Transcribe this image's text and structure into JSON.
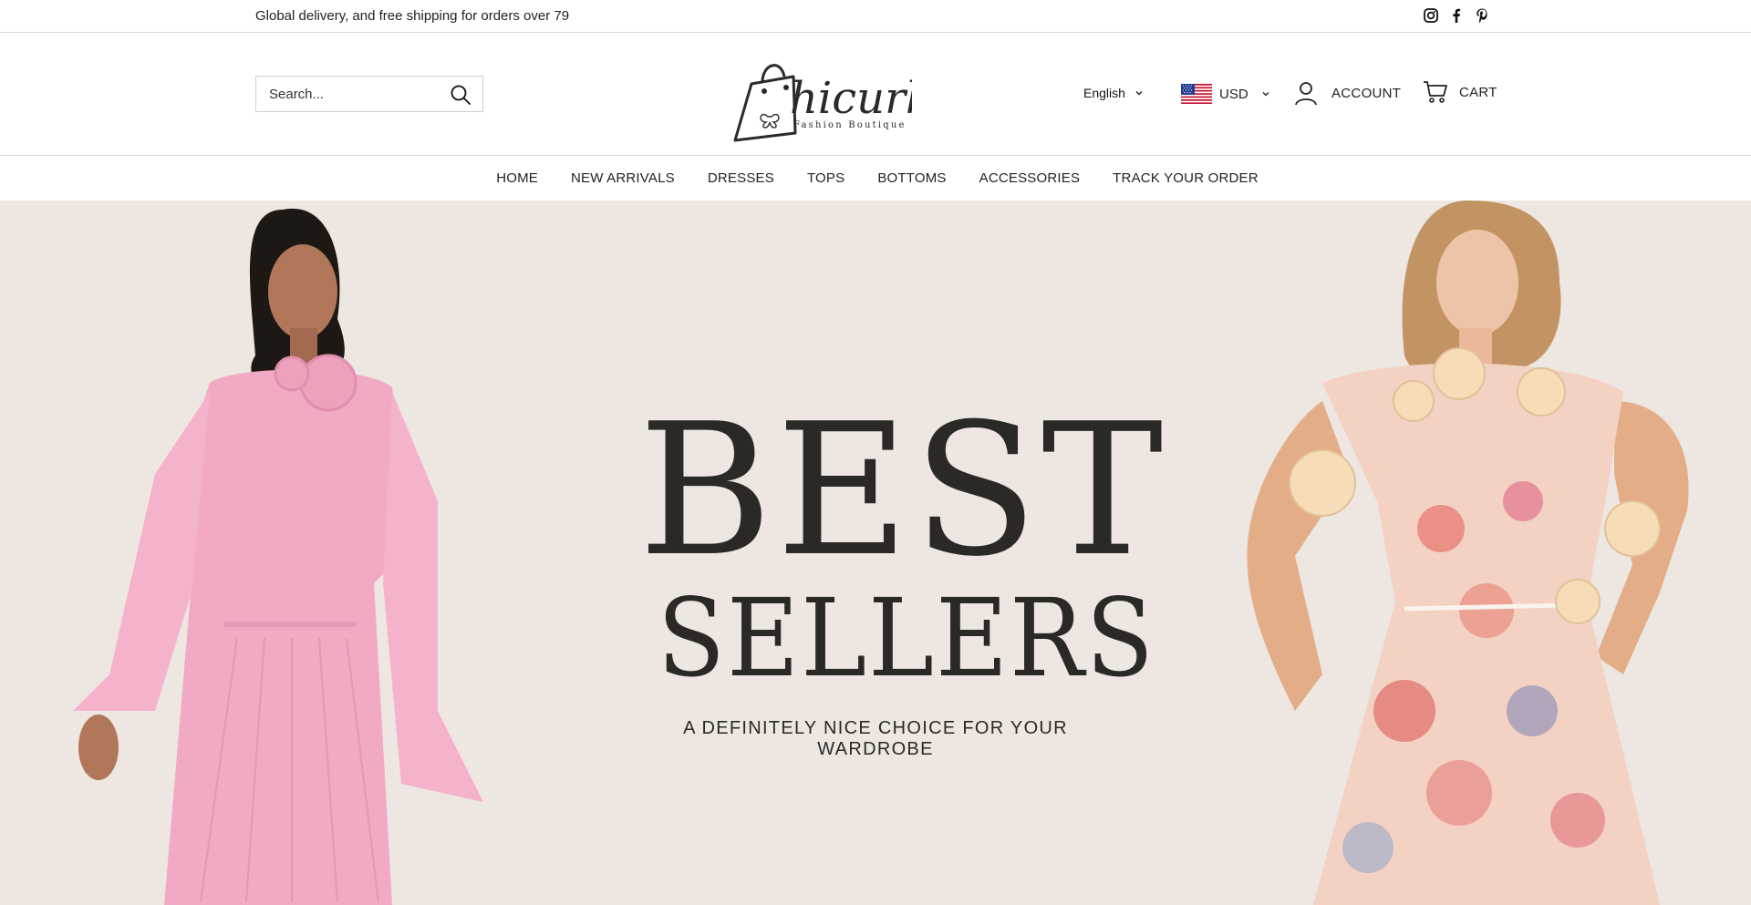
{
  "announcement": {
    "text": "Global delivery, and free shipping for orders over 79",
    "social": [
      "instagram-icon",
      "facebook-icon",
      "pinterest-icon"
    ]
  },
  "header": {
    "search": {
      "placeholder": "Search..."
    },
    "logo": {
      "brand": "hicurb",
      "tagline": "Fashion Boutique"
    },
    "language": {
      "selected": "English"
    },
    "currency": {
      "selected": "USD",
      "flag": "us-flag"
    },
    "account_label": "ACCOUNT",
    "cart_label": "CART"
  },
  "nav": {
    "items": [
      {
        "label": "HOME"
      },
      {
        "label": "NEW ARRIVALS"
      },
      {
        "label": "DRESSES"
      },
      {
        "label": "TOPS"
      },
      {
        "label": "BOTTOMS"
      },
      {
        "label": "ACCESSORIES"
      },
      {
        "label": "TRACK YOUR ORDER"
      }
    ]
  },
  "hero": {
    "title_line1": "BEST",
    "title_line2": "SELLERS",
    "tagline": "A DEFINITELY NICE CHOICE FOR YOUR WARDROBE",
    "background": "#ede6e1"
  },
  "colors": {
    "text": "#222222",
    "hero_text": "#2b2926",
    "border": "#d9d9d9"
  }
}
